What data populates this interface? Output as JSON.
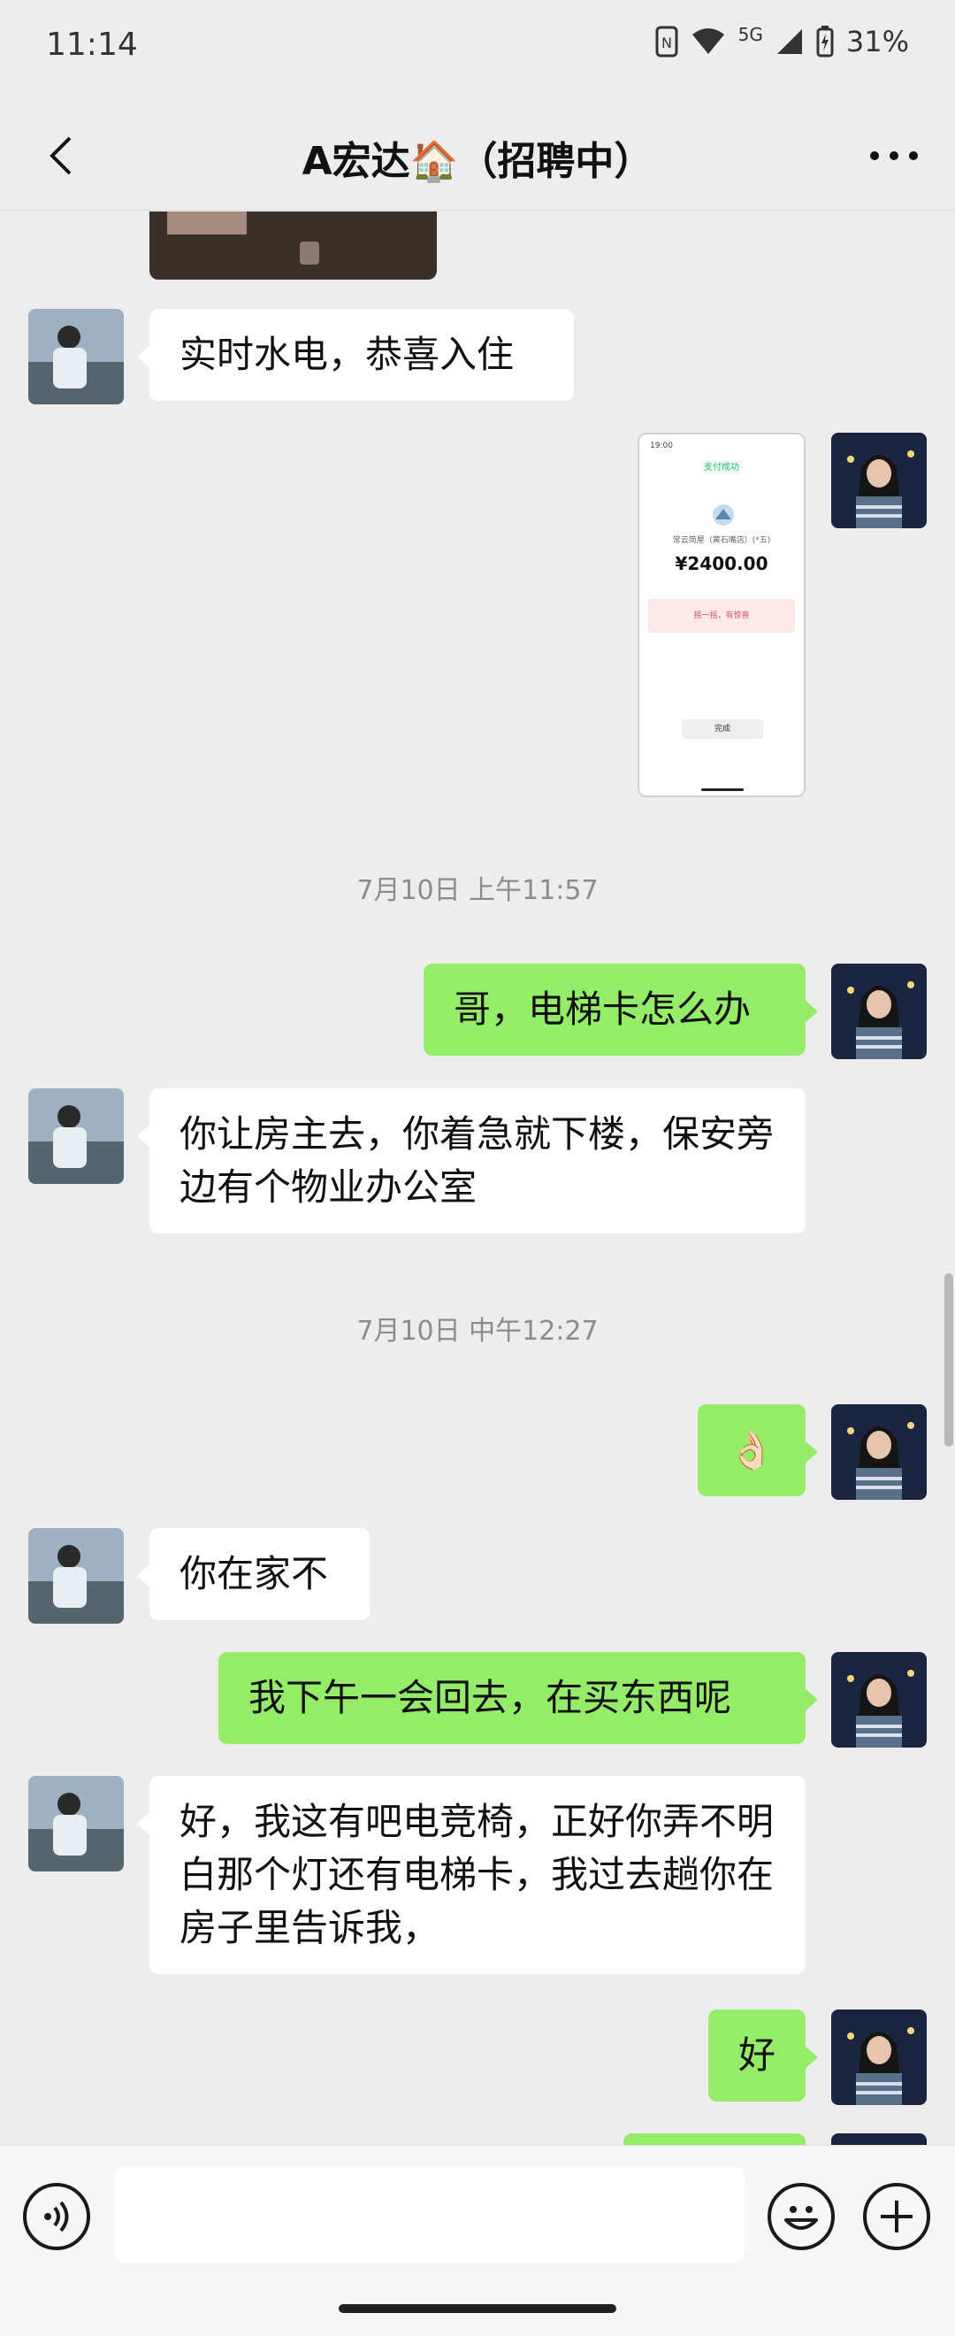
{
  "status_bar": {
    "time": "11:14",
    "network": "5G",
    "battery": "31%"
  },
  "nav": {
    "title": "A宏达🏠（招聘中）",
    "back_icon": "chevron-left-icon",
    "more_icon": "more-dots-icon"
  },
  "messages": [
    {
      "type": "text",
      "side": "in",
      "text": "实时水电，恭喜入住"
    },
    {
      "type": "image",
      "side": "out",
      "content": {
        "success": "支付成功",
        "merchant": "常云简屋（黄石嘴店）(*五)",
        "amount": "¥2400.00",
        "banner": "摇一摇，有惊喜",
        "done": "完成"
      }
    },
    {
      "type": "time",
      "text": "7月10日 上午11:57"
    },
    {
      "type": "text",
      "side": "out",
      "text": "哥，电梯卡怎么办"
    },
    {
      "type": "text",
      "side": "in",
      "text": "你让房主去，你着急就下楼，保安旁边有个物业办公室"
    },
    {
      "type": "time",
      "text": "7月10日 中午12:27"
    },
    {
      "type": "text",
      "side": "out",
      "text": "👌🏻"
    },
    {
      "type": "text",
      "side": "in",
      "text": "你在家不"
    },
    {
      "type": "text",
      "side": "out",
      "text": "我下午一会回去，在买东西呢"
    },
    {
      "type": "text",
      "side": "in",
      "text": "好，我这有吧电竞椅，正好你弄不明白那个灯还有电梯卡，我过去趟你在房子里告诉我，"
    },
    {
      "type": "text",
      "side": "out",
      "text": "好"
    }
  ],
  "input_bar": {
    "placeholder": "",
    "voice_icon": "voice-icon",
    "emoji_icon": "emoji-icon",
    "plus_icon": "plus-icon"
  },
  "colors": {
    "background": "#ededed",
    "bubble_out": "#95ec69",
    "bubble_in": "#ffffff"
  }
}
